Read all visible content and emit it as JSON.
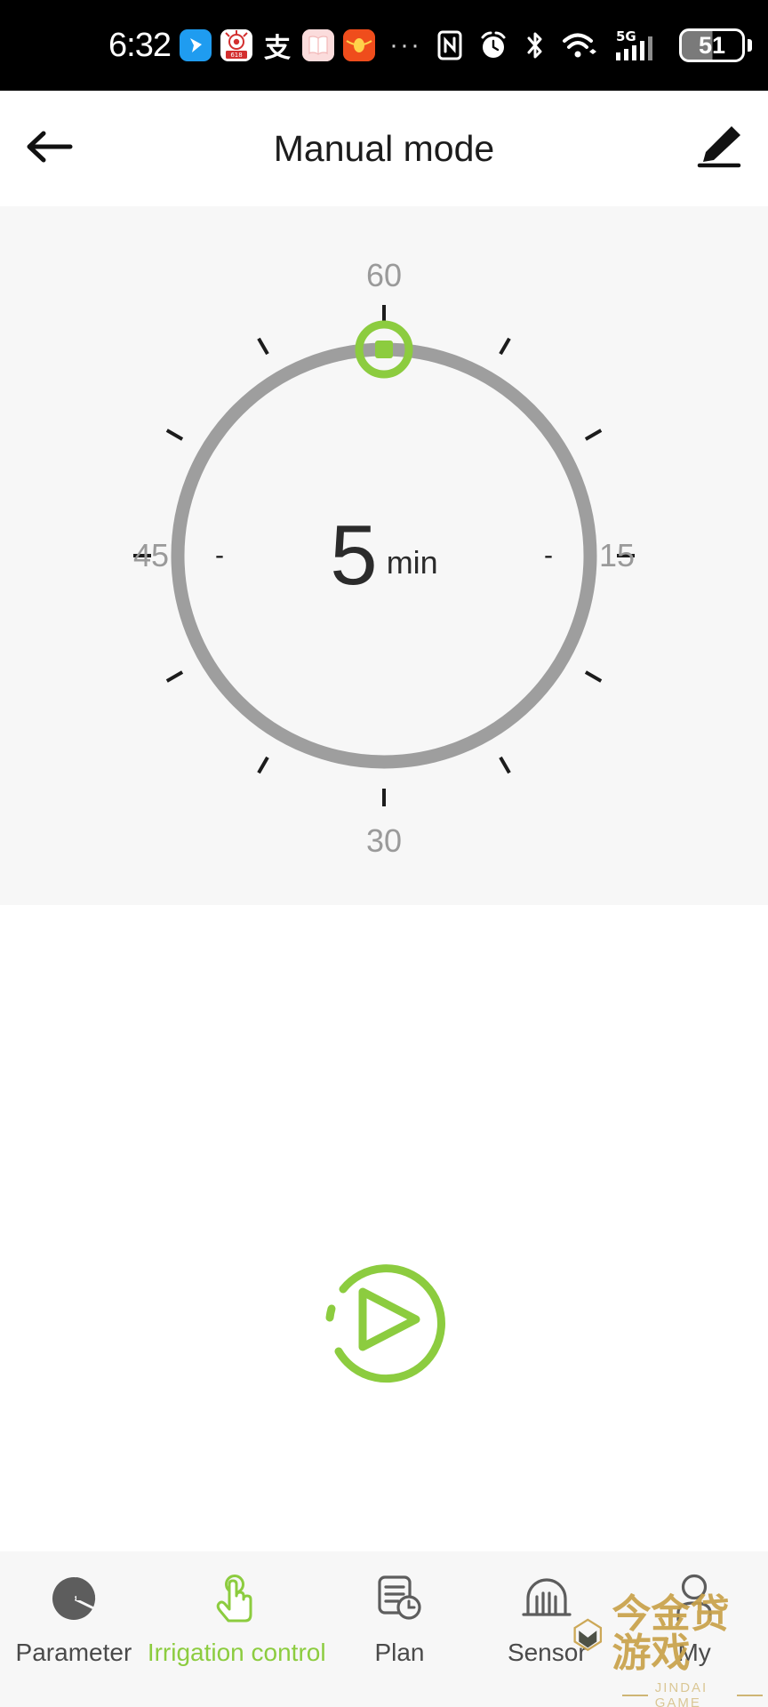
{
  "status_bar": {
    "time": "6:32",
    "left_icons": [
      "messenger-app-icon",
      "618-festival-app-icon",
      "alipay-app-icon",
      "book-app-icon",
      "redpacket-app-icon"
    ],
    "overflow": "···",
    "right_icons": [
      "nfc-icon",
      "alarm-icon",
      "bluetooth-icon",
      "wifi-icon",
      "signal-5g-icon"
    ],
    "network_label": "5G",
    "battery_percent": "51"
  },
  "header": {
    "back_icon": "back-arrow-icon",
    "title": "Manual mode",
    "edit_icon": "edit-pencil-icon"
  },
  "dial": {
    "value": "5",
    "unit": "min",
    "label_top": "60",
    "label_right": "15",
    "label_bottom": "30",
    "label_left": "45",
    "dash_left": "-",
    "dash_right": "-",
    "knob_position_minutes": 60,
    "track_color": "#9e9e9e",
    "knob_color": "#8ccc3f"
  },
  "play": {
    "icon": "play-circle-icon",
    "color": "#8ccc3f"
  },
  "bottom_nav": {
    "items": [
      {
        "label": "Parameter",
        "icon": "pie-chart-icon",
        "active": false
      },
      {
        "label": "Irrigation control",
        "icon": "hand-tap-icon",
        "active": true
      },
      {
        "label": "Plan",
        "icon": "document-clock-icon",
        "active": false
      },
      {
        "label": "Sensor",
        "icon": "sensor-icon",
        "active": false
      },
      {
        "label": "My",
        "icon": "person-icon",
        "active": false
      }
    ]
  },
  "watermark": {
    "cn": "今金贷游戏",
    "en": "JINDAI GAME"
  }
}
